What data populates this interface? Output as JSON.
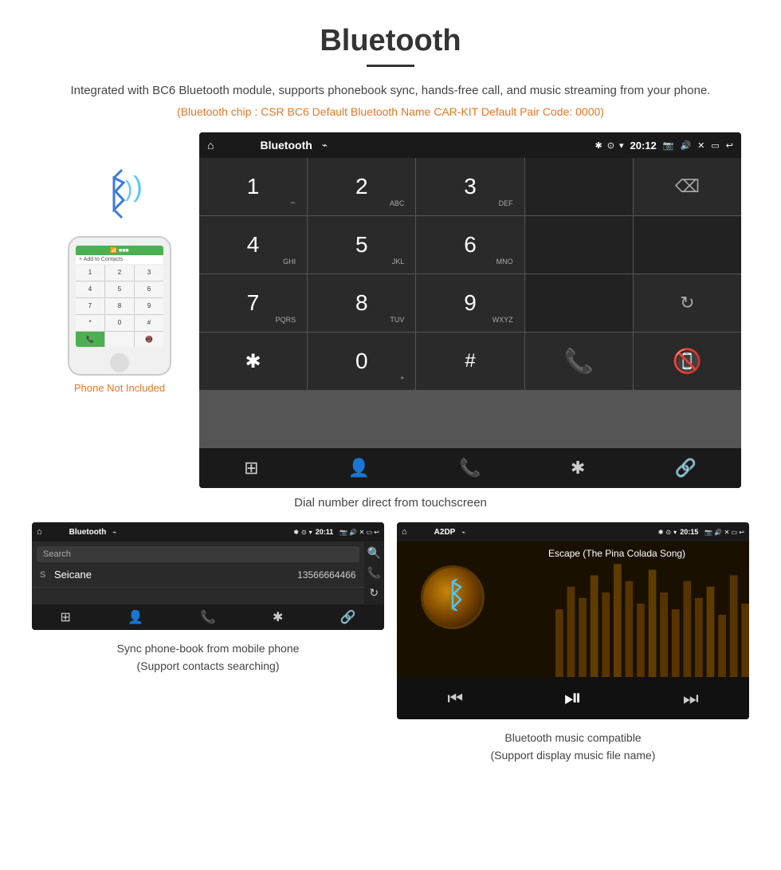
{
  "header": {
    "title": "Bluetooth",
    "subtitle": "Integrated with BC6 Bluetooth module, supports phonebook sync, hands-free call, and music streaming from your phone.",
    "orange_info": "(Bluetooth chip : CSR BC6    Default Bluetooth Name CAR-KIT    Default Pair Code: 0000)"
  },
  "main_screen": {
    "status_bar": {
      "title": "Bluetooth",
      "usb_icon": "⌁",
      "time": "20:12",
      "icons": "❊ ⊙ ▾"
    },
    "dial_keys": [
      {
        "num": "1",
        "sub": "∽"
      },
      {
        "num": "2",
        "sub": "ABC"
      },
      {
        "num": "3",
        "sub": "DEF"
      },
      {
        "num": "",
        "sub": ""
      },
      {
        "num": "⌫",
        "sub": ""
      },
      {
        "num": "4",
        "sub": "GHI"
      },
      {
        "num": "5",
        "sub": "JKL"
      },
      {
        "num": "6",
        "sub": "MNO"
      },
      {
        "num": "",
        "sub": ""
      },
      {
        "num": "",
        "sub": ""
      },
      {
        "num": "7",
        "sub": "PQRS"
      },
      {
        "num": "8",
        "sub": "TUV"
      },
      {
        "num": "9",
        "sub": "WXYZ"
      },
      {
        "num": "",
        "sub": ""
      },
      {
        "num": "↻",
        "sub": ""
      },
      {
        "num": "*",
        "sub": ""
      },
      {
        "num": "0",
        "sub": "+"
      },
      {
        "num": "#",
        "sub": ""
      },
      {
        "num": "📞",
        "sub": ""
      },
      {
        "num": "📵",
        "sub": ""
      }
    ],
    "bottom_nav_icons": [
      "⊞",
      "👤",
      "📞",
      "✱",
      "🔗"
    ]
  },
  "caption_main": "Dial number direct from touchscreen",
  "phonebook_screen": {
    "status": {
      "title": "Bluetooth",
      "time": "20:11"
    },
    "search_placeholder": "Search",
    "contact": {
      "letter": "S",
      "name": "Seicane",
      "number": "13566664466"
    },
    "side_icons": [
      "🔍",
      "📞",
      "↻"
    ],
    "bottom_nav": [
      "⊞",
      "👤",
      "📞",
      "✱",
      "🔗"
    ]
  },
  "caption_phonebook": "Sync phone-book from mobile phone\n(Support contacts searching)",
  "music_screen": {
    "status": {
      "title": "A2DP",
      "time": "20:15"
    },
    "song_title": "Escape (The Pina Colada Song)",
    "controls": [
      "⏮",
      "⏯",
      "⏭"
    ]
  },
  "caption_music": "Bluetooth music compatible\n(Support display music file name)",
  "phone_side": {
    "not_included": "Phone Not Included"
  }
}
